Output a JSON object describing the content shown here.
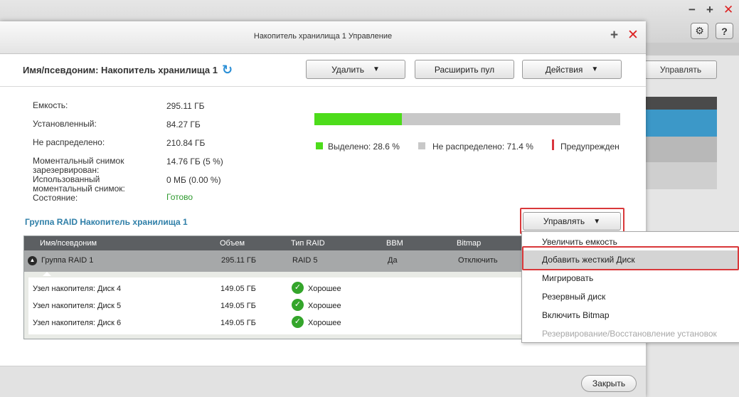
{
  "background": {
    "window_controls": [
      "−",
      "+",
      "✕"
    ],
    "tool_icons": [
      "settings-icon",
      "help-icon"
    ],
    "help_glyph": "?",
    "manage_label": "Управлять"
  },
  "dialog": {
    "title": "Накопитель хранилища 1 Управление",
    "title_plus": "+",
    "title_close": "✕",
    "name_label": "Имя/псевдоним: Накопитель хранилища 1",
    "buttons": {
      "delete": "Удалить",
      "expand_pool": "Расширить пул",
      "actions": "Действия"
    },
    "info": [
      {
        "label": "Емкость:",
        "value": "295.11 ГБ"
      },
      {
        "label": "Установленный:",
        "value": "84.27 ГБ"
      },
      {
        "label": "Не распределено:",
        "value": "210.84 ГБ"
      },
      {
        "label": "Моментальный снимок зарезервирован:",
        "value": "14.76 ГБ (5 %)"
      },
      {
        "label": "Использованный моментальный снимок:",
        "value": "0 МБ (0.00 %)"
      },
      {
        "label": "Состояние:",
        "value": "Готово"
      }
    ],
    "usage": {
      "allocated_fraction": 0.286,
      "allocated_label": "Выделено: 28.6 %",
      "unallocated_label": "Не распределено: 71.4 %",
      "warning_label": "Предупрежден",
      "colors": {
        "allocated": "#4ddc1b",
        "unallocated": "#c8c8c8",
        "warning": "#d9363e"
      }
    },
    "raid_section_title": "Группа RAID Накопитель хранилища 1",
    "manage_button": "Управлять",
    "table": {
      "headers": {
        "name": "Имя/псевдоним",
        "size": "Объем",
        "raid": "Тип RAID",
        "bbm": "BBM",
        "bitmap": "Bitmap"
      },
      "group": {
        "name": "Группа RAID 1",
        "size": "295.11 ГБ",
        "raid": "RAID 5",
        "bbm": "Да",
        "bitmap": "Отключить"
      },
      "disks": [
        {
          "name": "Узел накопителя: Диск 4",
          "size": "149.05 ГБ",
          "status": "Хорошее"
        },
        {
          "name": "Узел накопителя: Диск 5",
          "size": "149.05 ГБ",
          "status": "Хорошее"
        },
        {
          "name": "Узел накопителя: Диск 6",
          "size": "149.05 ГБ",
          "status": "Хорошее"
        }
      ]
    },
    "footer": {
      "close": "Закрыть"
    }
  },
  "manage_menu": {
    "items": [
      {
        "label": "Увеличить емкость"
      },
      {
        "label": "Добавить жесткий Диск"
      },
      {
        "label": "Мигрировать"
      },
      {
        "label": "Резервный диск"
      },
      {
        "label": "Включить Bitmap"
      },
      {
        "label": "Резервирование/Восстановление установок"
      }
    ]
  }
}
